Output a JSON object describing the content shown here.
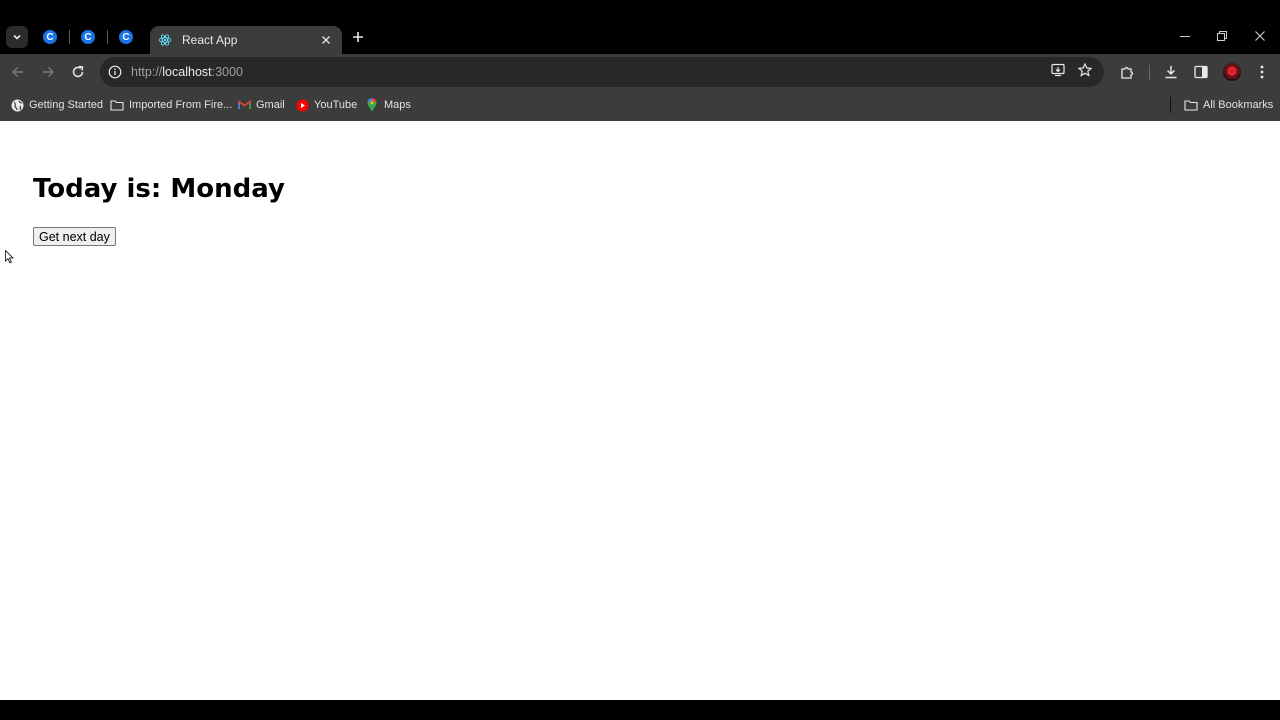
{
  "browser": {
    "tabs": {
      "mini_tabs": [
        {
          "favicon_letter": "C"
        },
        {
          "favicon_letter": "C"
        },
        {
          "favicon_letter": "C"
        }
      ],
      "active_tab_title": "React App"
    },
    "address_bar": {
      "scheme": "http://",
      "host": "localhost",
      "port": ":3000"
    },
    "bookmarks": [
      {
        "label": "Getting Started",
        "icon": "globe-icon"
      },
      {
        "label": "Imported From Fire...",
        "icon": "folder-icon"
      },
      {
        "label": "Gmail",
        "icon": "gmail-icon"
      },
      {
        "label": "YouTube",
        "icon": "youtube-icon"
      },
      {
        "label": "Maps",
        "icon": "maps-pin-icon"
      }
    ],
    "all_bookmarks_label": "All Bookmarks",
    "colors": {
      "tab_strip": "#000000",
      "toolbar": "#3c3c3c",
      "omnibox": "#282828"
    }
  },
  "page": {
    "heading": "Today is: Monday",
    "next_day_button": "Get next day"
  }
}
